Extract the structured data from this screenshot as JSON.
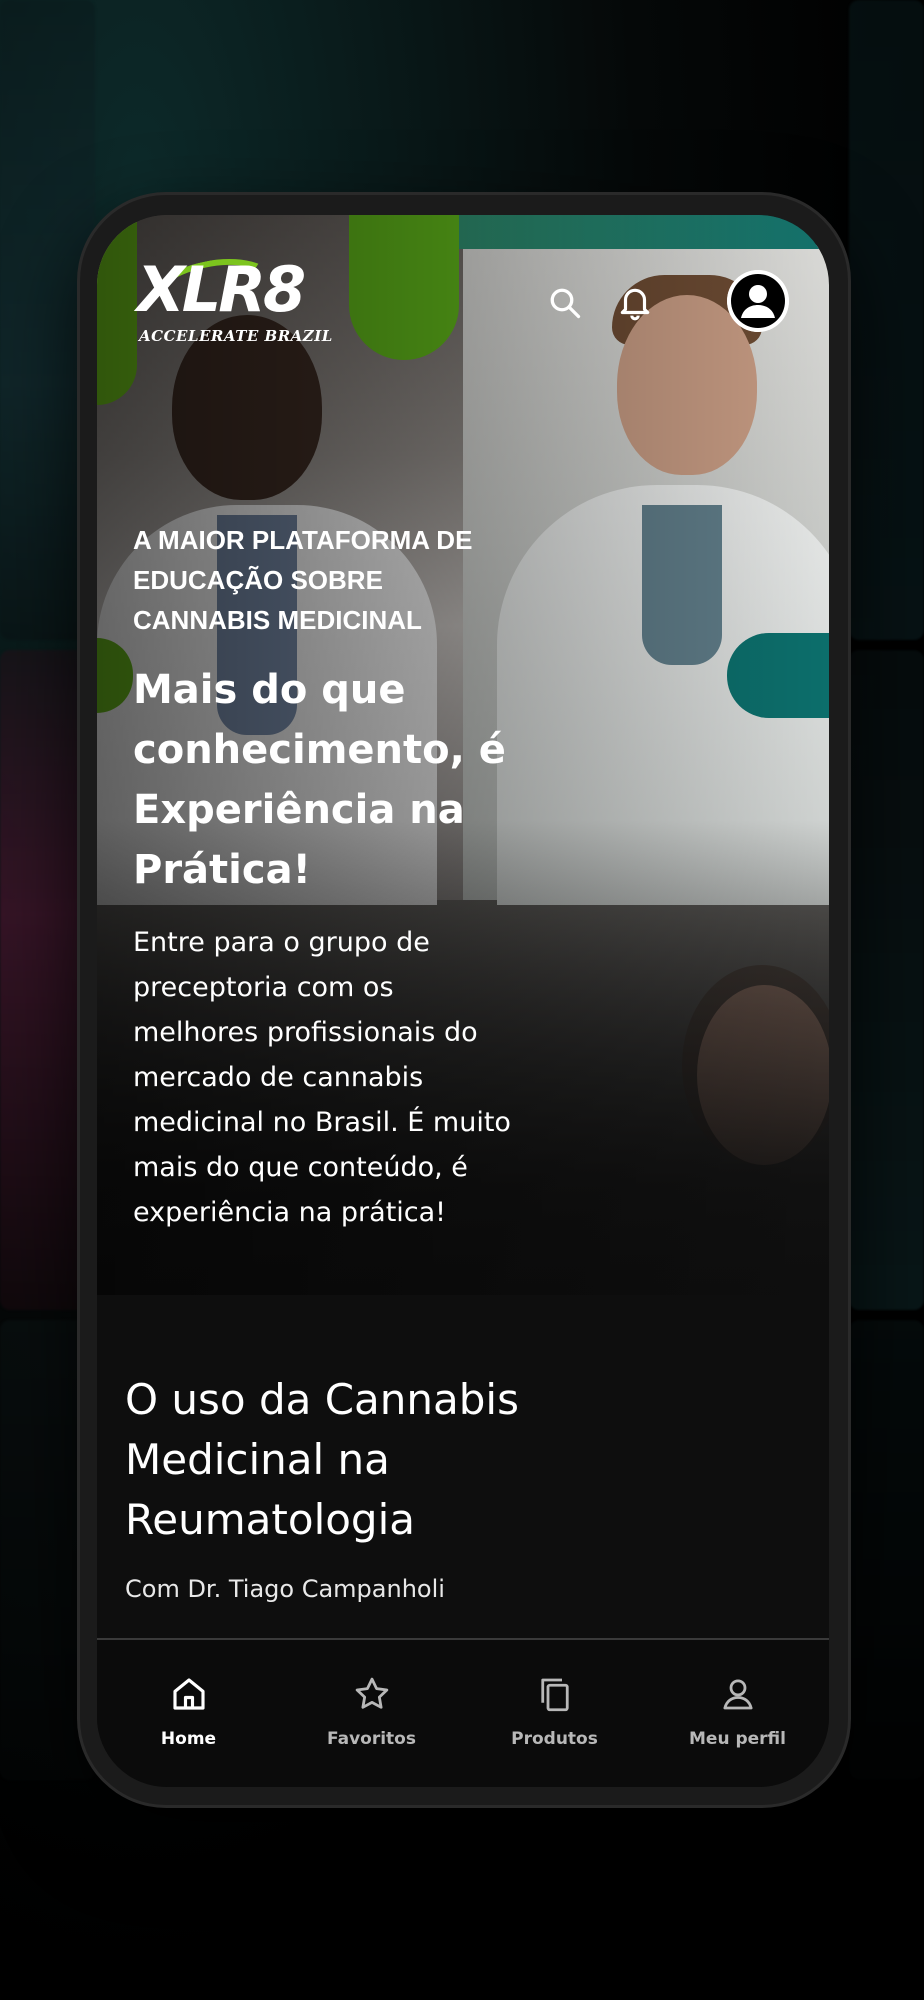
{
  "brand": {
    "logo_text": "XLR8",
    "tagline": "ACCELERATE BRAZIL"
  },
  "header": {
    "icons": [
      "search-icon",
      "bell-icon",
      "user-avatar-icon"
    ]
  },
  "hero": {
    "eyebrow": "A MAIOR PLATAFORMA DE\nEDUCAÇÃO SOBRE\nCANNABIS MEDICINAL",
    "headline": "Mais do que\nconhecimento, é\nExperiência na\nPrática!",
    "description": "Entre para o grupo de\npreceptoria com os\nmelhores profissionais do\nmercado de cannabis\nmedicinal no Brasil. É muito\nmais do que conteúdo, é\nexperiência na prática!"
  },
  "course": {
    "title": "O uso da Cannabis\nMedicinal na\nReumatologia",
    "author": "Com Dr. Tiago Campanholi"
  },
  "bottom_nav": {
    "items": [
      {
        "label": "Home",
        "icon": "home-icon",
        "active": true
      },
      {
        "label": "Favoritos",
        "icon": "star-icon",
        "active": false
      },
      {
        "label": "Produtos",
        "icon": "copy-icon",
        "active": false
      },
      {
        "label": "Meu perfil",
        "icon": "user-icon",
        "active": false
      }
    ]
  },
  "colors": {
    "accent_green": "#6cbf1a",
    "accent_teal": "#0c6e6b",
    "background": "#0e0e0e"
  }
}
